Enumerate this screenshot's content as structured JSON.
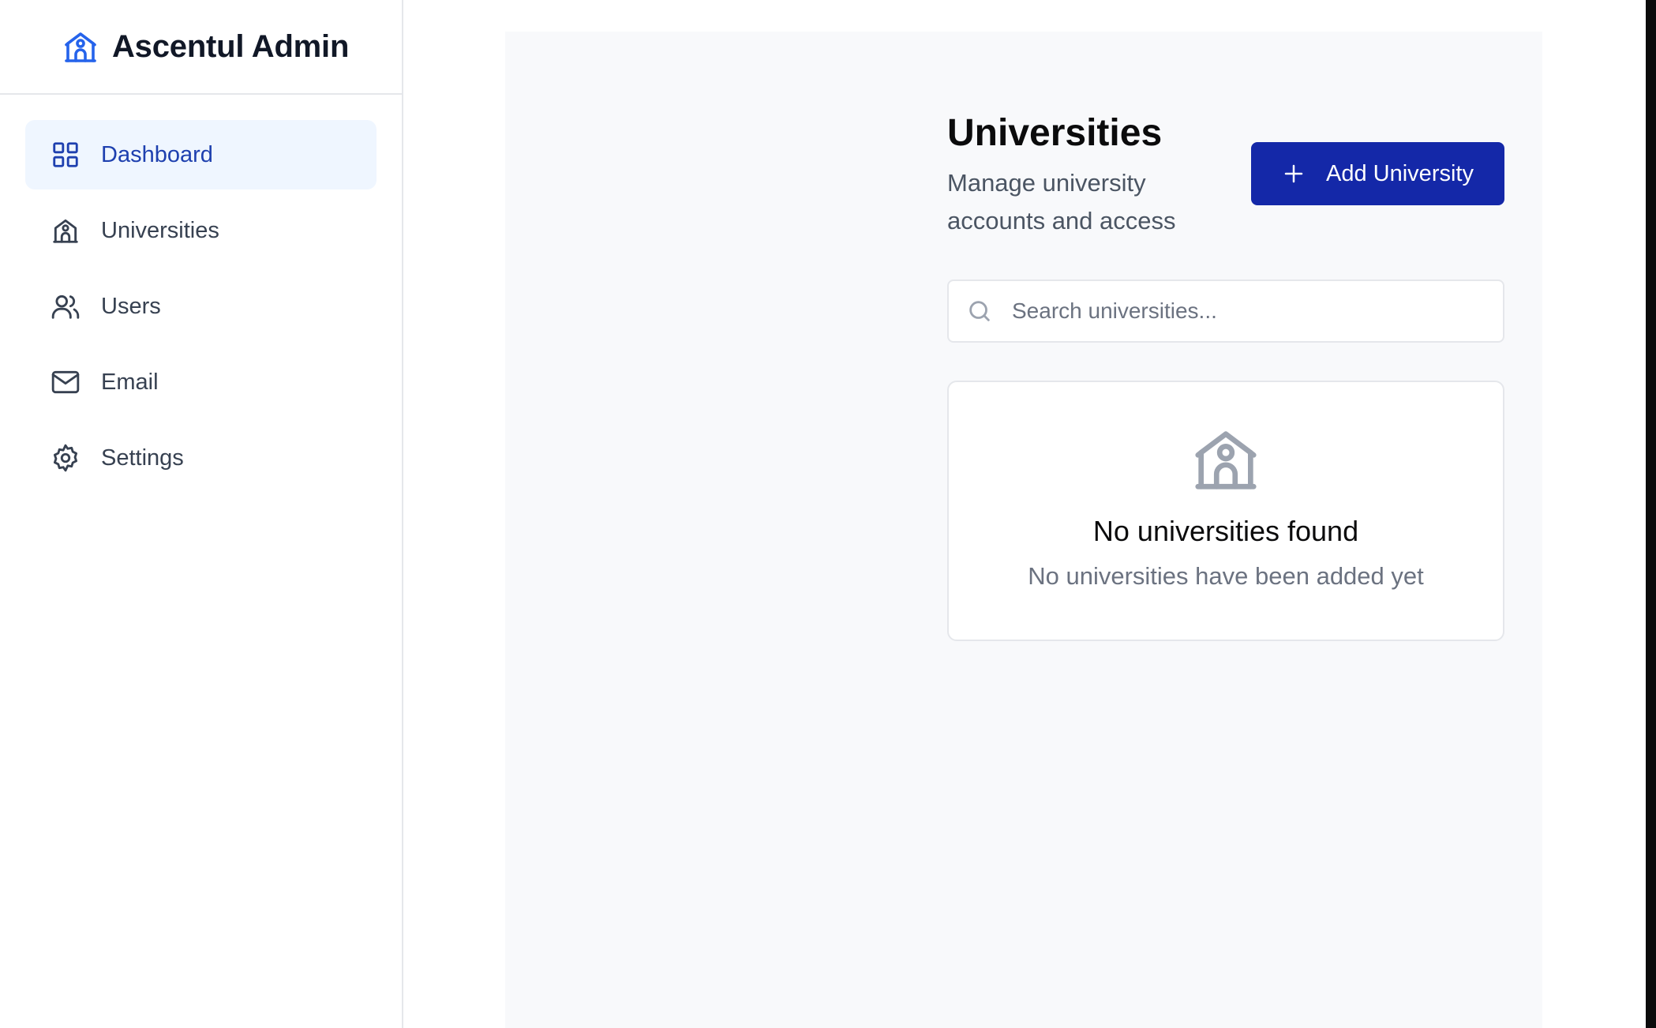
{
  "brand": {
    "title": "Ascentul Admin",
    "icon": "school-building-icon"
  },
  "sidebar": {
    "items": [
      {
        "label": "Dashboard",
        "icon": "grid-icon",
        "active": true
      },
      {
        "label": "Universities",
        "icon": "school-building-icon",
        "active": false
      },
      {
        "label": "Users",
        "icon": "users-icon",
        "active": false
      },
      {
        "label": "Email",
        "icon": "mail-icon",
        "active": false
      },
      {
        "label": "Settings",
        "icon": "gear-icon",
        "active": false
      }
    ]
  },
  "main": {
    "title": "Universities",
    "subtitle": "Manage university accounts and access",
    "add_button_label": "Add University",
    "search": {
      "placeholder": "Search universities...",
      "value": ""
    },
    "empty_state": {
      "icon": "school-building-icon",
      "title": "No universities found",
      "text": "No universities have been added yet"
    }
  },
  "colors": {
    "accent": "#1428a8",
    "active_nav_bg": "#eff6ff",
    "active_nav_text": "#1e40af",
    "brand_icon": "#2563eb"
  }
}
